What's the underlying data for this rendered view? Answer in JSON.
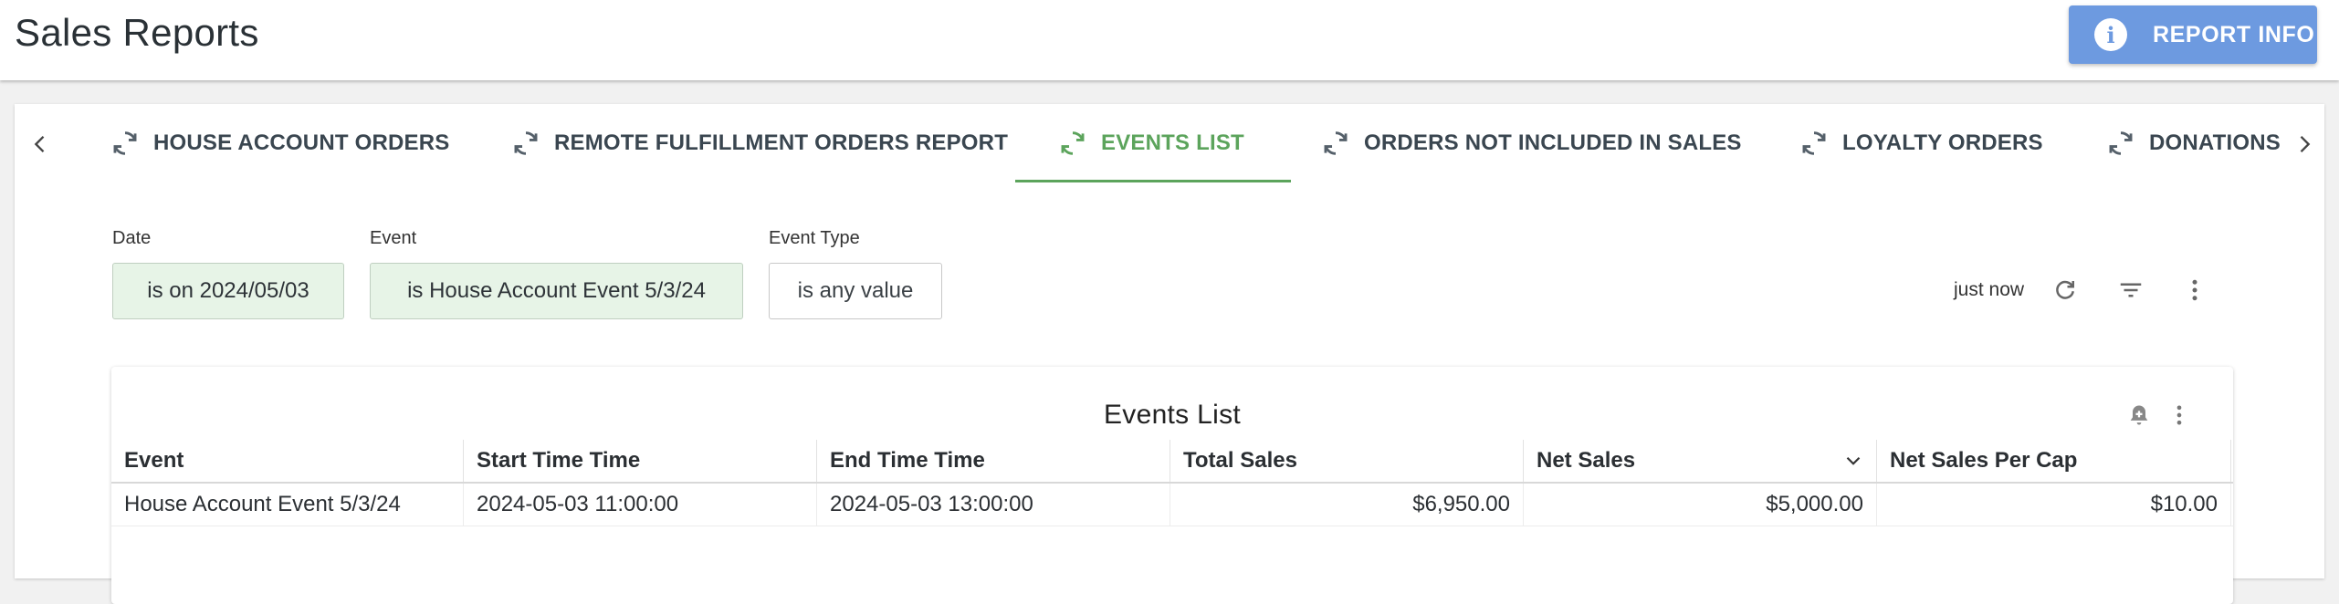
{
  "header": {
    "title": "Sales Reports",
    "report_info_label": "REPORT INFO",
    "report_info_icon": "info-icon"
  },
  "tabs": [
    {
      "label": "HOUSE ACCOUNT ORDERS",
      "icon": "refresh-icon",
      "active": false
    },
    {
      "label": "REMOTE FULFILLMENT ORDERS REPORT",
      "icon": "refresh-icon",
      "active": false
    },
    {
      "label": "EVENTS LIST",
      "icon": "refresh-icon",
      "active": true
    },
    {
      "label": "ORDERS NOT INCLUDED IN SALES",
      "icon": "refresh-icon",
      "active": false
    },
    {
      "label": "LOYALTY ORDERS",
      "icon": "refresh-icon",
      "active": false
    },
    {
      "label": "DONATIONS",
      "icon": "refresh-icon",
      "active": false
    }
  ],
  "filters": [
    {
      "label": "Date",
      "value": "is on 2024/05/03",
      "applied": true
    },
    {
      "label": "Event",
      "value": "is House Account Event 5/3/24",
      "applied": true
    },
    {
      "label": "Event Type",
      "value": "is any value",
      "applied": false
    }
  ],
  "controls": {
    "last_updated": "just now",
    "icons": [
      "refresh-icon",
      "filter-icon",
      "more-vert-icon"
    ]
  },
  "tile": {
    "title": "Events List",
    "icons": [
      "alert-bell-icon",
      "more-vert-icon"
    ],
    "columns": [
      "Event",
      "Start Time Time",
      "End Time Time",
      "Total Sales",
      "Net Sales",
      "Net Sales Per Cap"
    ],
    "sorted_column": "Net Sales",
    "sort_direction": "descending",
    "rows": [
      [
        "House Account Event 5/3/24",
        "2024-05-03 11:00:00",
        "2024-05-03 13:00:00",
        "$6,950.00",
        "$5,000.00",
        "$10.00"
      ]
    ]
  },
  "colors": {
    "accent_green": "#5ca45c",
    "button_blue": "#6d9ae0",
    "chip_bg": "#e7f4e7"
  }
}
